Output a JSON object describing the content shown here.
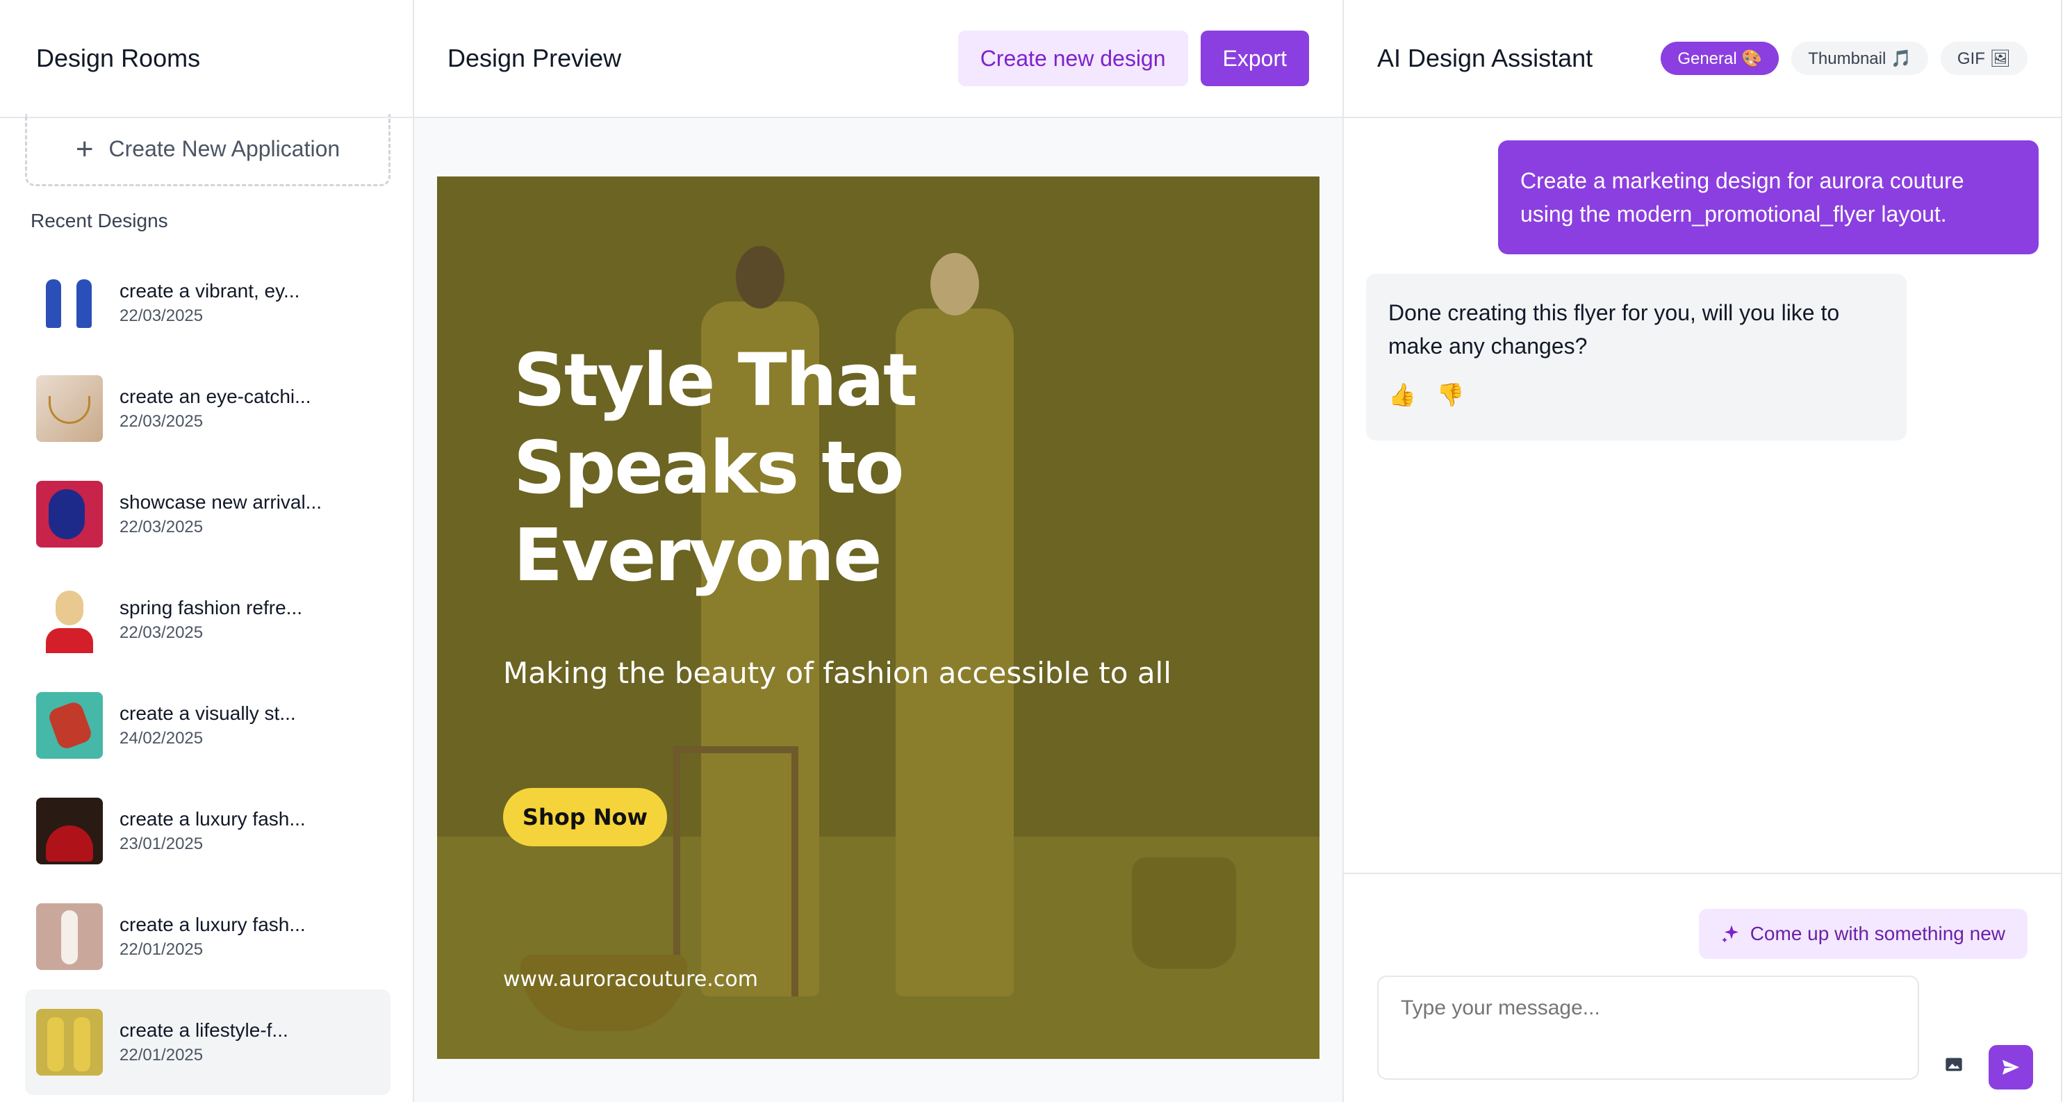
{
  "sidebar": {
    "title": "Design Rooms",
    "create_label": "Create New Application",
    "recent_label": "Recent Designs",
    "items": [
      {
        "title": "create a vibrant, ey...",
        "date": "22/03/2025"
      },
      {
        "title": "create an eye-catchi...",
        "date": "22/03/2025"
      },
      {
        "title": "showcase new arrival...",
        "date": "22/03/2025"
      },
      {
        "title": "spring fashion refre...",
        "date": "22/03/2025"
      },
      {
        "title": "create a visually st...",
        "date": "24/02/2025"
      },
      {
        "title": "create a luxury fash...",
        "date": "23/01/2025"
      },
      {
        "title": "create a luxury fash...",
        "date": "22/01/2025"
      },
      {
        "title": "create a lifestyle-f...",
        "date": "22/01/2025"
      }
    ]
  },
  "preview": {
    "title": "Design Preview",
    "create_button": "Create new design",
    "export_button": "Export",
    "flyer": {
      "headline": "Style That Speaks to Everyone",
      "subline": "Making the beauty of fashion accessible to all",
      "cta": "Shop Now",
      "url": "www.auroracouture.com"
    }
  },
  "assistant": {
    "title": "AI Design Assistant",
    "chips": [
      "General 🎨",
      "Thumbnail 🎵",
      "GIF 🖼"
    ],
    "user_message": "Create a marketing design for aurora couture using the modern_promotional_flyer layout.",
    "ai_message": "Done creating this flyer for you, will you like to make any changes?",
    "reactions": [
      "👍",
      "👎"
    ],
    "suggest_label": "Come up with something new",
    "input_placeholder": "Type your message..."
  },
  "colors": {
    "accent": "#8b3fe0",
    "accent_light": "#f3e8ff",
    "cta_yellow": "#f5d33b"
  }
}
